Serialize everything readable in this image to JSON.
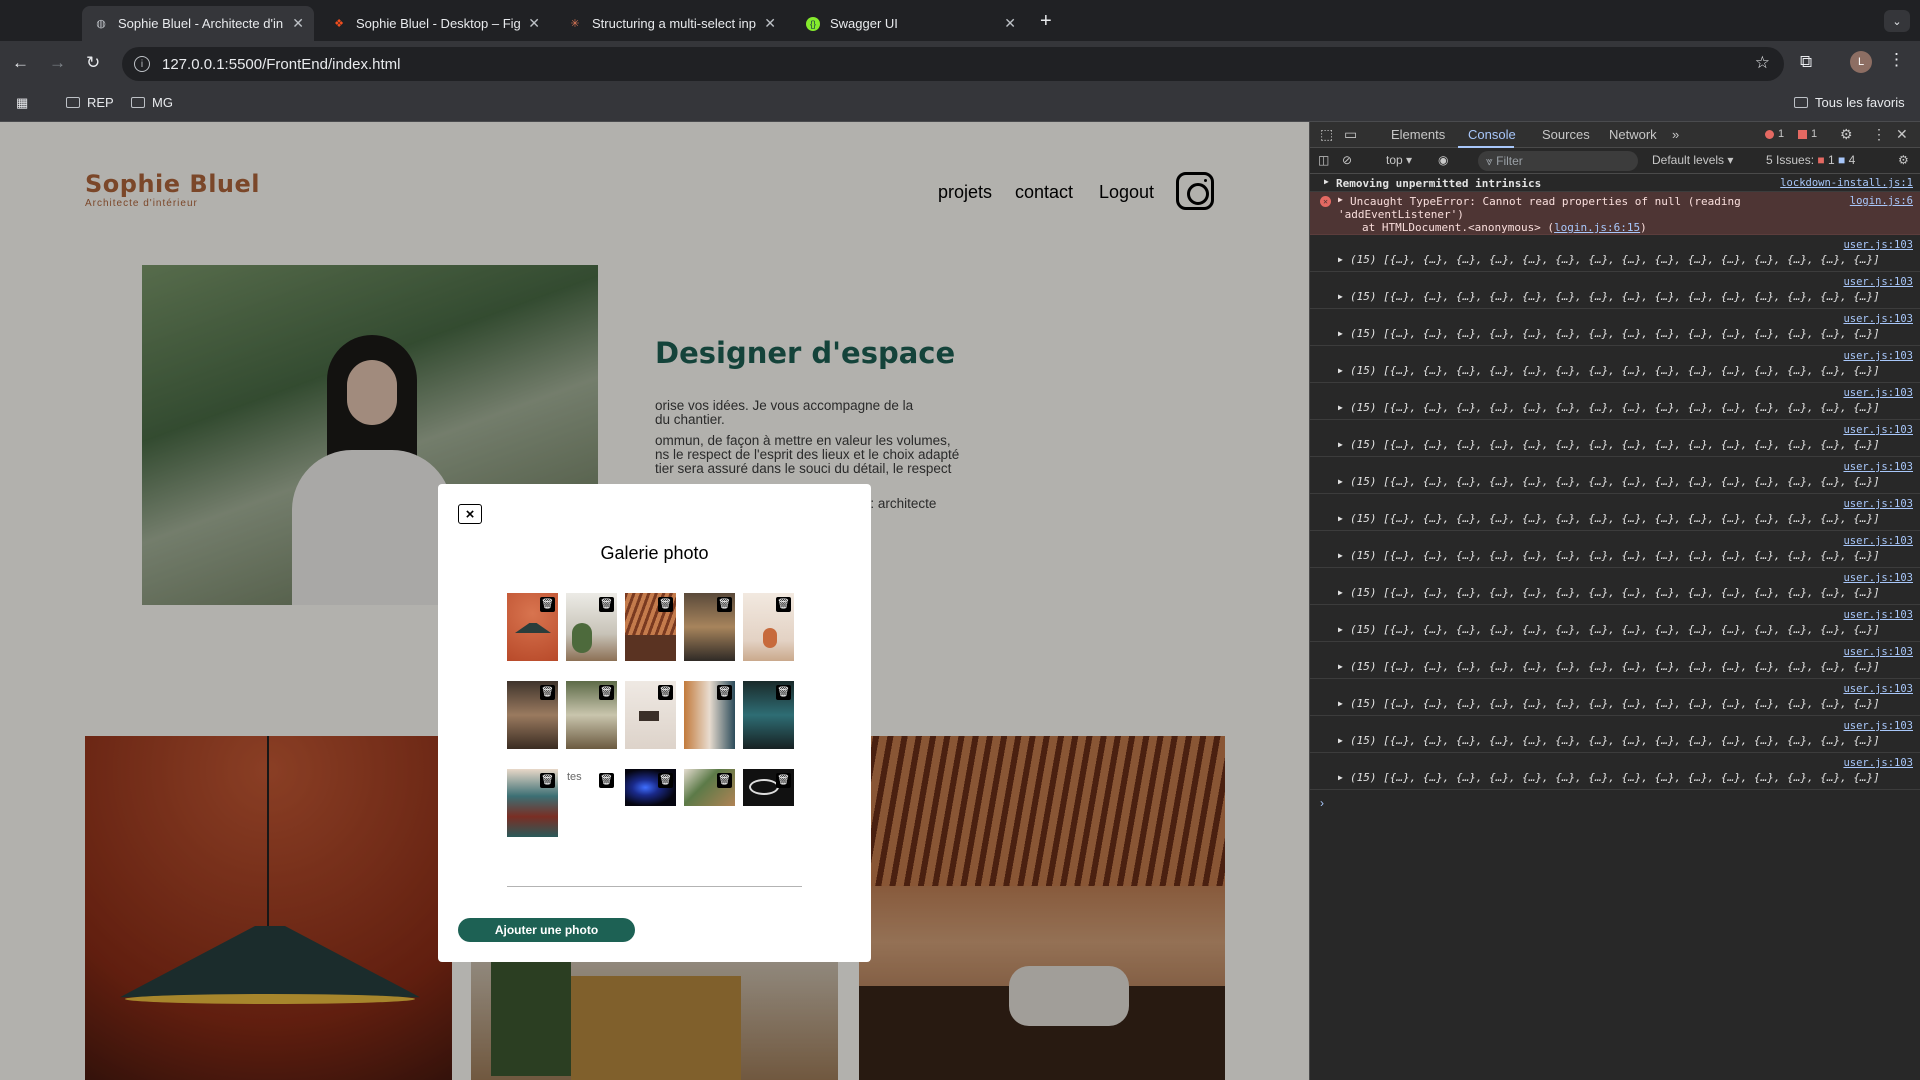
{
  "browser": {
    "tabs": [
      {
        "title": "Sophie Bluel - Architecte d'in",
        "active": true
      },
      {
        "title": "Sophie Bluel - Desktop – Figm",
        "active": false
      },
      {
        "title": "Structuring a multi-select inp",
        "active": false
      },
      {
        "title": "Swagger UI",
        "active": false
      }
    ],
    "url": "127.0.0.1:5500/FrontEnd/index.html",
    "profile_initial": "L",
    "bookmarks": [
      "REP",
      "MG"
    ],
    "all_bookmarks_label": "Tous les favoris"
  },
  "site": {
    "logo_title": "Sophie Bluel",
    "logo_subtitle": "Architecte d'intérieur",
    "nav": [
      "projets",
      "contact",
      "Logout"
    ],
    "about_title": "Designer d'espace",
    "about_lines": [
      "orise vos idées. Je vous accompagne de la",
      "du chantier.",
      "ommun, de façon à mettre en valeur les volumes,",
      "ns le respect de l'esprit des lieux et le choix adapté",
      "tier sera assuré dans le souci du détail, le respect",
      "luridisciplinaire peut-être constituée : architecte"
    ]
  },
  "modal": {
    "close_label": "×",
    "title": "Galerie photo",
    "broken_alt": "tes",
    "add_button": "Ajouter une photo"
  },
  "devtools": {
    "tabs": [
      "Elements",
      "Console",
      "Sources",
      "Network"
    ],
    "more": "»",
    "error_count": "1",
    "warn_count": "1",
    "context": "top",
    "filter_placeholder": "Filter",
    "levels": "Default levels",
    "issues_label": "5 Issues:",
    "issues_err": "1",
    "issues_info": "4",
    "messages": [
      {
        "kind": "warn",
        "text": "Removing unpermitted intrinsics",
        "source": "lockdown-install.js:1"
      },
      {
        "kind": "error",
        "line1": "Uncaught TypeError: Cannot read properties of null (reading",
        "line2": "'addEventListener')",
        "line3": "at HTMLDocument.<anonymous> (",
        "line3_link": "login.js:6:15",
        "line3_end": ")",
        "source": "login.js:6"
      }
    ],
    "log_source": "user.js:103",
    "log_text": "(15) [{…}, {…}, {…}, {…}, {…}, {…}, {…}, {…}, {…}, {…}, {…}, {…}, {…}, {…}, {…}]",
    "log_count": 15
  },
  "colors": {
    "brand": "#b1663c",
    "accent": "#1d6154",
    "devtools_link": "#a8c7fa"
  }
}
